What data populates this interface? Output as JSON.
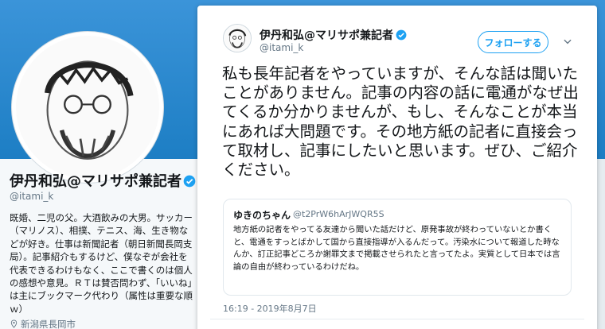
{
  "profile": {
    "name": "伊丹和弘@マリサポ兼記者",
    "handle": "@itami_k",
    "bio": "既婚、二児の父。大酒飲みの大男。サッカー（マリノス）、相撲、テニス、海、生き物などが好き。仕事は新聞記者（朝日新聞長岡支局）。記事紹介もするけど、僕なぞが会社を代表できるわけもなく、ここで書くのは個人の感想や意見。ＲＴは賛否問わず、「いいね」は主にブックマーク代わり（属性は重要な順ｗ）",
    "location": "新潟県長岡市"
  },
  "tweet": {
    "author_name": "伊丹和弘@マリサポ兼記者",
    "author_handle": "@itami_k",
    "follow_label": "フォローする",
    "text": "私も長年記者をやっていますが、そんな話は聞いたことがありません。記事の内容の話に電通がなぜ出てくるか分かりませんが、もし、そんなことが本当にあれば大問題です。その地方紙の記者に直接会って取材し、記事にしたいと思います。ぜひ、ご紹介ください。",
    "timestamp": "16:19 - 2019年8月7日"
  },
  "quote": {
    "name": "ゆきのちゃん",
    "handle": "@t2PrW6hArJWQR5S",
    "text": "地方紙の記者をやってる友達から聞いた話だけど、原発事故が終わっていないとか書くと、電通をすっとばかして国から直接指導が入るんだって。汚染水について報道した時なんか、訂正記事どころか謝罪文まで掲載させられたと言ってたよ。実質として日本では言論の自由が終わっているわけだね。"
  },
  "colors": {
    "accent": "#1da1f2",
    "header": "#1d7ec4",
    "text": "#14171a",
    "muted": "#657786"
  },
  "icons": [
    "verified-badge-icon",
    "chevron-down-icon",
    "location-pin-icon"
  ]
}
